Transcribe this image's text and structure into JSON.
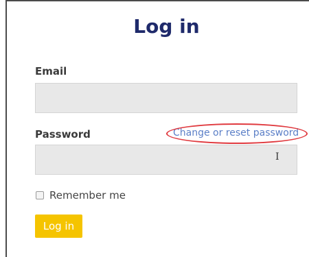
{
  "page": {
    "title": "Log in"
  },
  "form": {
    "email_label": "Email",
    "email_value": "",
    "password_label": "Password",
    "password_value": "",
    "reset_link": "Change or reset password",
    "remember_label": "Remember me",
    "remember_checked": false,
    "submit_label": "Log in"
  },
  "annotation": {
    "highlight_color": "#e0393e"
  },
  "colors": {
    "title": "#1f2a6b",
    "link": "#5b7fc7",
    "button": "#f5c400"
  }
}
